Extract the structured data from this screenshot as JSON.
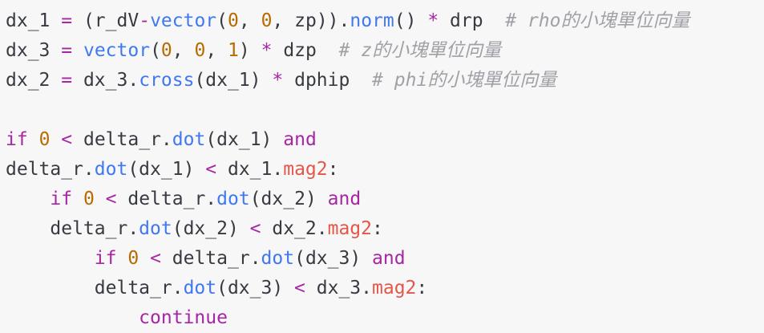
{
  "editor": {
    "colors": {
      "background": "#f7f7f7",
      "plain": "#383a42",
      "operator": "#a626a4",
      "function": "#4078f2",
      "number": "#b76b01",
      "keyword": "#a626a4",
      "attribute": "#e45649",
      "comment": "#a0a1a7"
    },
    "lines": [
      [
        {
          "t": "dx_1 ",
          "c": "plain"
        },
        {
          "t": "=",
          "c": "op"
        },
        {
          "t": " (r_dV",
          "c": "plain"
        },
        {
          "t": "-",
          "c": "op"
        },
        {
          "t": "vector",
          "c": "func"
        },
        {
          "t": "(",
          "c": "plain"
        },
        {
          "t": "0",
          "c": "num"
        },
        {
          "t": ", ",
          "c": "plain"
        },
        {
          "t": "0",
          "c": "num"
        },
        {
          "t": ", zp)).",
          "c": "plain"
        },
        {
          "t": "norm",
          "c": "func"
        },
        {
          "t": "() ",
          "c": "plain"
        },
        {
          "t": "*",
          "c": "op"
        },
        {
          "t": " drp  ",
          "c": "plain"
        },
        {
          "t": "# rho的小塊單位向量",
          "c": "comment"
        }
      ],
      [
        {
          "t": "dx_3 ",
          "c": "plain"
        },
        {
          "t": "=",
          "c": "op"
        },
        {
          "t": " ",
          "c": "plain"
        },
        {
          "t": "vector",
          "c": "func"
        },
        {
          "t": "(",
          "c": "plain"
        },
        {
          "t": "0",
          "c": "num"
        },
        {
          "t": ", ",
          "c": "plain"
        },
        {
          "t": "0",
          "c": "num"
        },
        {
          "t": ", ",
          "c": "plain"
        },
        {
          "t": "1",
          "c": "num"
        },
        {
          "t": ") ",
          "c": "plain"
        },
        {
          "t": "*",
          "c": "op"
        },
        {
          "t": " dzp  ",
          "c": "plain"
        },
        {
          "t": "# z的小塊單位向量",
          "c": "comment"
        }
      ],
      [
        {
          "t": "dx_2 ",
          "c": "plain"
        },
        {
          "t": "=",
          "c": "op"
        },
        {
          "t": " dx_3.",
          "c": "plain"
        },
        {
          "t": "cross",
          "c": "func"
        },
        {
          "t": "(dx_1) ",
          "c": "plain"
        },
        {
          "t": "*",
          "c": "op"
        },
        {
          "t": " dphip  ",
          "c": "plain"
        },
        {
          "t": "# phi的小塊單位向量",
          "c": "comment"
        }
      ],
      [],
      [
        {
          "t": "if",
          "c": "kw"
        },
        {
          "t": " ",
          "c": "plain"
        },
        {
          "t": "0",
          "c": "num"
        },
        {
          "t": " ",
          "c": "plain"
        },
        {
          "t": "<",
          "c": "op"
        },
        {
          "t": " delta_r.",
          "c": "plain"
        },
        {
          "t": "dot",
          "c": "func"
        },
        {
          "t": "(dx_1) ",
          "c": "plain"
        },
        {
          "t": "and",
          "c": "kw"
        }
      ],
      [
        {
          "t": "delta_r.",
          "c": "plain"
        },
        {
          "t": "dot",
          "c": "func"
        },
        {
          "t": "(dx_1) ",
          "c": "plain"
        },
        {
          "t": "<",
          "c": "op"
        },
        {
          "t": " dx_1.",
          "c": "plain"
        },
        {
          "t": "mag2",
          "c": "attr"
        },
        {
          "t": ":",
          "c": "plain"
        }
      ],
      [
        {
          "t": "    ",
          "c": "plain"
        },
        {
          "t": "if",
          "c": "kw"
        },
        {
          "t": " ",
          "c": "plain"
        },
        {
          "t": "0",
          "c": "num"
        },
        {
          "t": " ",
          "c": "plain"
        },
        {
          "t": "<",
          "c": "op"
        },
        {
          "t": " delta_r.",
          "c": "plain"
        },
        {
          "t": "dot",
          "c": "func"
        },
        {
          "t": "(dx_2) ",
          "c": "plain"
        },
        {
          "t": "and",
          "c": "kw"
        }
      ],
      [
        {
          "t": "    delta_r.",
          "c": "plain"
        },
        {
          "t": "dot",
          "c": "func"
        },
        {
          "t": "(dx_2) ",
          "c": "plain"
        },
        {
          "t": "<",
          "c": "op"
        },
        {
          "t": " dx_2.",
          "c": "plain"
        },
        {
          "t": "mag2",
          "c": "attr"
        },
        {
          "t": ":",
          "c": "plain"
        }
      ],
      [
        {
          "t": "        ",
          "c": "plain"
        },
        {
          "t": "if",
          "c": "kw"
        },
        {
          "t": " ",
          "c": "plain"
        },
        {
          "t": "0",
          "c": "num"
        },
        {
          "t": " ",
          "c": "plain"
        },
        {
          "t": "<",
          "c": "op"
        },
        {
          "t": " delta_r.",
          "c": "plain"
        },
        {
          "t": "dot",
          "c": "func"
        },
        {
          "t": "(dx_3) ",
          "c": "plain"
        },
        {
          "t": "and",
          "c": "kw"
        }
      ],
      [
        {
          "t": "        delta_r.",
          "c": "plain"
        },
        {
          "t": "dot",
          "c": "func"
        },
        {
          "t": "(dx_3) ",
          "c": "plain"
        },
        {
          "t": "<",
          "c": "op"
        },
        {
          "t": " dx_3.",
          "c": "plain"
        },
        {
          "t": "mag2",
          "c": "attr"
        },
        {
          "t": ":",
          "c": "plain"
        }
      ],
      [
        {
          "t": "            ",
          "c": "plain"
        },
        {
          "t": "continue",
          "c": "kw"
        }
      ]
    ]
  }
}
